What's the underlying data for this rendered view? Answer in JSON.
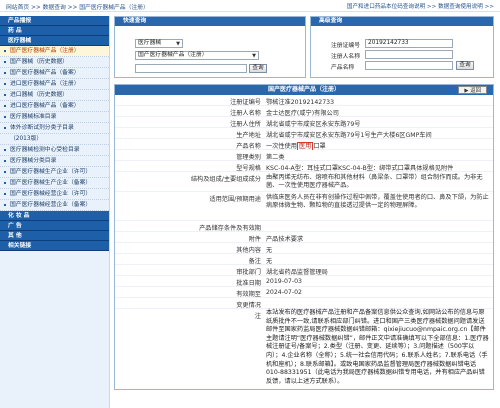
{
  "topbar": {
    "home": "网站首页",
    "crumb_sep1": ">>",
    "crumb1": "数据查询",
    "crumb_sep2": ">>",
    "crumb2": "国产医疗器械产品（注册）",
    "right_text": "国产和进口药品本位码查询说明 >> 数据查询使用说明 >>"
  },
  "sidebar": {
    "sections": [
      {
        "header": "产品播报"
      },
      {
        "header": "药  品"
      },
      {
        "header": "医疗器械"
      }
    ],
    "device_items": [
      "国产医疗器械产品（注册）",
      "国产器械（历史数据）",
      "国产医疗器械产品（备案）",
      "进口医疗器械产品（注册）",
      "进口器械（历史数据）",
      "进口医疗器械产品（备案）",
      "医疗器械标准目录",
      "体外诊断试剂分类子目录",
      "（2013版）",
      "医疗器械检测中心受检目录",
      "医疗器械分类目录",
      "国产医疗器械生产企业（许可）",
      "国产医疗器械生产企业（备案）",
      "国产医疗器械经营企业（许可）",
      "国产医疗器械经营企业（备案）"
    ],
    "bottom_sections": [
      {
        "header": "化 妆 品"
      },
      {
        "header": "广  告"
      },
      {
        "header": "其  他"
      },
      {
        "header": "相关链接"
      }
    ]
  },
  "quick_search": {
    "title": "快速查询",
    "category_value": "医疗器械",
    "subcategory_value": "国产医疗器械产品（注册）",
    "keyword_value": "",
    "button_label": "查询"
  },
  "advanced_search": {
    "title": "高级查询",
    "field1_label": "注册证编号",
    "field1_value": "20192142733",
    "field2_label": "注册人名称",
    "field2_value": "",
    "field3_label": "产品名称",
    "field3_value": "",
    "button_label": "查询"
  },
  "detail": {
    "title": "国产医疗器械产品（注册）",
    "back_label": "▶ 返回",
    "fields": [
      {
        "key": "注册证编号",
        "value": "鄂械注准20192142733"
      },
      {
        "key": "注册人名称",
        "value": "金士达医疗(咸宁)有限公司"
      },
      {
        "key": "注册人住所",
        "value": "湖北省咸宁市咸安区永安东路79号"
      },
      {
        "key": "生产地址",
        "value": "湖北省咸宁市咸安区永安东路79号1号生产大楼6区GMP车间"
      },
      {
        "key": "产品名称",
        "value_pre": "一次性使用",
        "value_hl": "医用",
        "value_post": "口罩"
      },
      {
        "key": "管理类别",
        "value": "第二类"
      },
      {
        "key": "型号规格",
        "value": "KSC-04-A型：耳挂式口罩KSC-04-B型：绑带式口罩具体规格见附件"
      }
    ],
    "structure": {
      "key": "结构及组成/主要组成成分",
      "value": "由聚丙烯无纺布、熔喷布和其他材料（鼻梁条、口罩带）组合制作而成。为非无菌、一次性使用医疗器械产品。"
    },
    "scope": {
      "key": "适用范围/预期用途",
      "value": "供临床医务人员在非有创操作过程中佩带，覆盖住使用者的口、鼻及下颌，为防止病原体微生物、颗粒物的直接透过提供一定的物理屏障。"
    },
    "fields2": [
      {
        "key": "产品储存条件及有效期",
        "value": ""
      },
      {
        "key": "附件",
        "value": "产品技术要求"
      },
      {
        "key": "其他内容",
        "value": "无"
      },
      {
        "key": "备注",
        "value": "无"
      },
      {
        "key": "审批部门",
        "value": "湖北省药品监督管理局"
      },
      {
        "key": "批准日期",
        "value": "2019-07-03"
      },
      {
        "key": "有效期至",
        "value": "2024-07-02"
      },
      {
        "key": "变更情况",
        "value": ""
      }
    ],
    "notice_key": "注",
    "notice_text": "本站发布的医疗器械产品注册和产品备案信息供公众查询,如网站公布的信息与原纸质批件不一致,请联系相应部门纠错。进口和国产三类医疗器械数据问题请发送邮件至国家药监局医疗器械数据纠错邮箱：qixiejiucuo@nmpaic.org.cn【邮件主题请注明“医疗器械数据纠错”，邮件正文中请准确填写以下全部信息：1.医疗器械注册证号/备案号；2.类型（注册、变更、延续等）；3.问题描述（500字以内）；4.企业名称（全称）；5.统一社会信用代码；6.联系人姓名；7.联系电话（手机和座机）；8.联系邮箱】。或致电国家药品监督管理局医疗器械数据纠错电话010-88331951（此电话为我局医疗器械数据纠错专用电话，并有相应产品纠错反馈，请以上述方式联系）。"
  },
  "colors": {
    "header_blue": "#2a67ad",
    "sidebar_bg": "#e9f1fb",
    "active_item_bg": "#fef6d8",
    "highlight_red": "#d63c2e"
  }
}
